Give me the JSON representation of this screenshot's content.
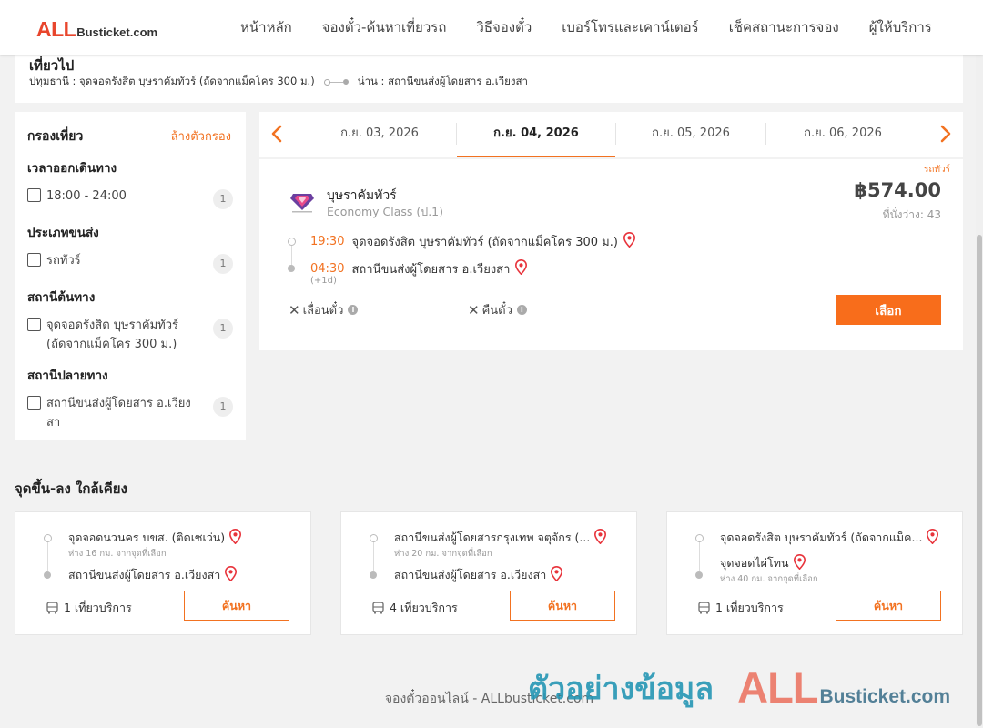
{
  "header": {
    "logo_all": "ALL",
    "logo_rest": "Busticket.com",
    "nav": [
      "หน้าหลัก",
      "จองตั๋ว-ค้นหาเที่ยวรถ",
      "วิธีจองตั๋ว",
      "เบอร์โทรและเคาน์เตอร์",
      "เช็คสถานะการจอง",
      "ผู้ให้บริการ"
    ]
  },
  "trip": {
    "title": "เที่ยวไป",
    "from": "ปทุมธานี : จุดจอดรังสิต บุษราคัมทัวร์ (ถัดจากแม็คโคร 300 ม.)",
    "to": "น่าน : สถานีขนส่งผู้โดยสาร อ.เวียงสา"
  },
  "filter": {
    "title": "กรองเที่ยว",
    "clear": "ล้างตัวกรอง",
    "sections": [
      {
        "title": "เวลาออกเดินทาง",
        "label": "18:00 - 24:00",
        "count": "1"
      },
      {
        "title": "ประเภทขนส่ง",
        "label": "รถทัวร์",
        "count": "1"
      },
      {
        "title": "สถานีต้นทาง",
        "label": "จุดจอดรังสิต บุษราคัมทัวร์ (ถัดจากแม็คโคร 300 ม.)",
        "count": "1"
      },
      {
        "title": "สถานีปลายทาง",
        "label": "สถานีขนส่งผู้โดยสาร อ.เวียงสา",
        "count": "1"
      }
    ]
  },
  "dates": {
    "tabs": [
      "ก.ย. 03, 2026",
      "ก.ย. 04, 2026",
      "ก.ย. 05, 2026",
      "ก.ย. 06, 2026"
    ],
    "active_index": 1
  },
  "result": {
    "badge": "รถทัวร์",
    "operator": "บุษราคัมทัวร์",
    "class": "Economy Class (ป.1)",
    "price": "฿574.00",
    "seats": "ที่นั่งว่าง: 43",
    "depart_time": "19:30",
    "depart_station": "จุดจอดรังสิต บุษราคัมทัวร์ (ถัดจากแม็คโคร 300 ม.)",
    "arrive_time": "04:30",
    "arrive_station": "สถานีขนส่งผู้โดยสาร อ.เวียงสา",
    "plus_day": "(+1d)",
    "change_policy": "เลื่อนตั๋ว",
    "refund_policy": "คืนตั๋ว",
    "select_label": "เลือก"
  },
  "nearby": {
    "title": "จุดขึ้น-ลง ใกล้เคียง",
    "cards": [
      {
        "from": "จุดจอดนวนคร บขส. (ติดเซเว่น)",
        "from_dist": "ห่าง 16 กม. จากจุดที่เลือก",
        "to": "สถานีขนส่งผู้โดยสาร อ.เวียงสา",
        "to_dist": "",
        "count": "1 เที่ยวบริการ",
        "button": "ค้นหา"
      },
      {
        "from": "สถานีขนส่งผู้โดยสารกรุงเทพ จตุจักร (...",
        "from_dist": "ห่าง 20 กม. จากจุดที่เลือก",
        "to": "สถานีขนส่งผู้โดยสาร อ.เวียงสา",
        "to_dist": "",
        "count": "4 เที่ยวบริการ",
        "button": "ค้นหา"
      },
      {
        "from": "จุดจอดรังสิต บุษราคัมทัวร์ (ถัดจากแม็ค...",
        "from_dist": "",
        "to": "จุดจอดไผ่โทน",
        "to_dist": "ห่าง 40 กม. จากจุดที่เลือก",
        "count": "1 เที่ยวบริการ",
        "button": "ค้นหา"
      }
    ]
  },
  "footer": "จองตั๋วออนไลน์ - ALLbusticket.com",
  "watermark": {
    "text": "ตัวอย่างข้อมูล",
    "logo_all": "ALL",
    "logo_rest": "Busticket.com"
  },
  "colors": {
    "accent": "#f27221",
    "button": "#f86d1b",
    "pin": "#e8343c",
    "logo_red": "#e8452c"
  }
}
